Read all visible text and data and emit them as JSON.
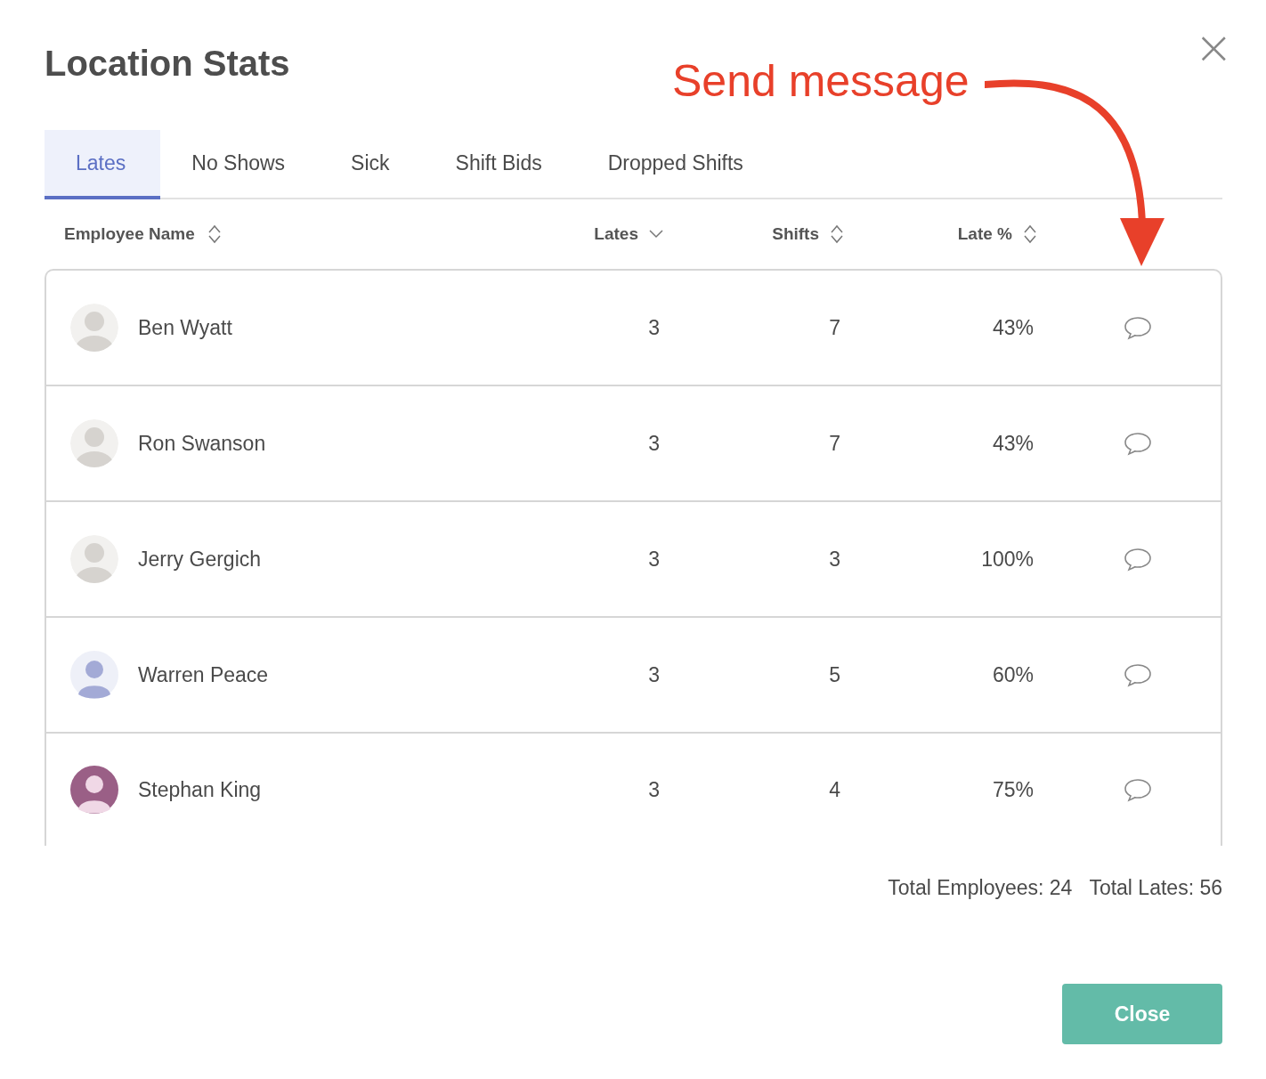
{
  "dialog": {
    "title": "Location Stats",
    "close_icon": "×"
  },
  "annotation": {
    "text": "Send message"
  },
  "tabs": [
    {
      "label": "Lates",
      "selected": true
    },
    {
      "label": "No Shows",
      "selected": false
    },
    {
      "label": "Sick",
      "selected": false
    },
    {
      "label": "Shift Bids",
      "selected": false
    },
    {
      "label": "Dropped Shifts",
      "selected": false
    }
  ],
  "table": {
    "columns": [
      {
        "label": "Employee Name",
        "sorted": false
      },
      {
        "label": "Lates",
        "sorted": true
      },
      {
        "label": "Shifts",
        "sorted": false
      },
      {
        "label": "Late %",
        "sorted": false
      }
    ],
    "rows": [
      {
        "avatar": {
          "kind": "photo"
        },
        "name": "Ben Wyatt",
        "lates": "3",
        "shifts": "7",
        "late_pct": "43%"
      },
      {
        "avatar": {
          "kind": "photo"
        },
        "name": "Ron Swanson",
        "lates": "3",
        "shifts": "7",
        "late_pct": "43%"
      },
      {
        "avatar": {
          "kind": "photo"
        },
        "name": "Jerry Gergich",
        "lates": "3",
        "shifts": "3",
        "late_pct": "100%"
      },
      {
        "avatar": {
          "kind": "tinted",
          "color": "#a3aad6"
        },
        "name": "Warren Peace",
        "lates": "3",
        "shifts": "5",
        "late_pct": "60%"
      },
      {
        "avatar": {
          "kind": "filled",
          "color": "#9a5f86"
        },
        "name": "Stephan King",
        "lates": "3",
        "shifts": "4",
        "late_pct": "75%"
      }
    ]
  },
  "totals": [
    {
      "text": "Total Employees: 24"
    },
    {
      "text": "Total Lates: 56"
    }
  ],
  "buttons": [
    {
      "label": "Close"
    }
  ]
}
